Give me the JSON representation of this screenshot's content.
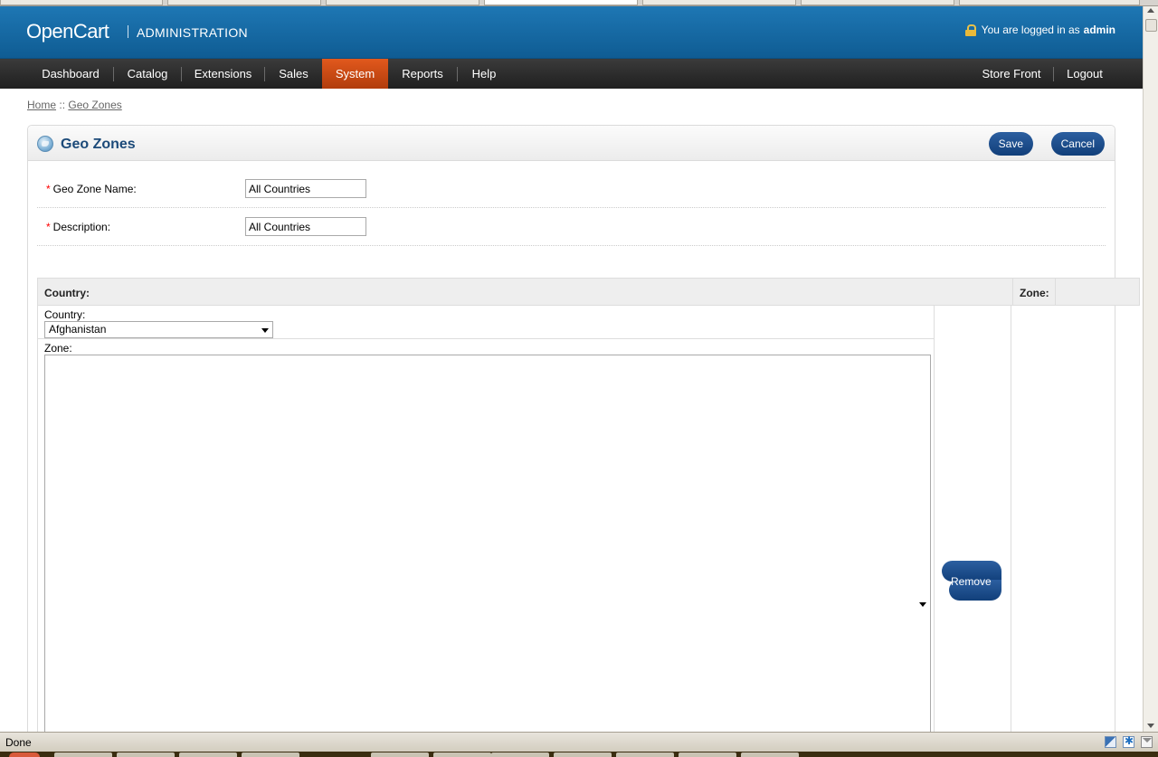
{
  "header": {
    "logo": "OpenCart",
    "logo_sub": "ADMINISTRATION",
    "login_prefix": "You are logged in as",
    "login_user": "admin"
  },
  "nav": {
    "items": [
      {
        "label": "Dashboard"
      },
      {
        "label": "Catalog"
      },
      {
        "label": "Extensions"
      },
      {
        "label": "Sales"
      },
      {
        "label": "System",
        "active": true
      },
      {
        "label": "Reports"
      },
      {
        "label": "Help"
      }
    ],
    "right": [
      {
        "label": "Store Front"
      },
      {
        "label": "Logout"
      }
    ]
  },
  "breadcrumb": {
    "home": "Home",
    "sep": "::",
    "current": "Geo Zones"
  },
  "page": {
    "title": "Geo Zones",
    "save_label": "Save",
    "cancel_label": "Cancel"
  },
  "form": {
    "name_label": "Geo Zone Name:",
    "name_value": "All Countries",
    "desc_label": "Description:",
    "desc_value": "All Countries",
    "required_mark": "*"
  },
  "zone_table": {
    "col_country": "Country:",
    "col_zone": "Zone:",
    "country_label": "Country:",
    "country_selected": "Afghanistan",
    "zone_label": "Zone:",
    "remove_label": "Remove"
  },
  "statusbar": {
    "text": "Done"
  },
  "colors": {
    "header_blue": "#1e77b4",
    "nav_dark": "#2a2a2a",
    "nav_active": "#e2591d",
    "button_blue": "#1d4f8d",
    "title_blue": "#1c4a79"
  }
}
